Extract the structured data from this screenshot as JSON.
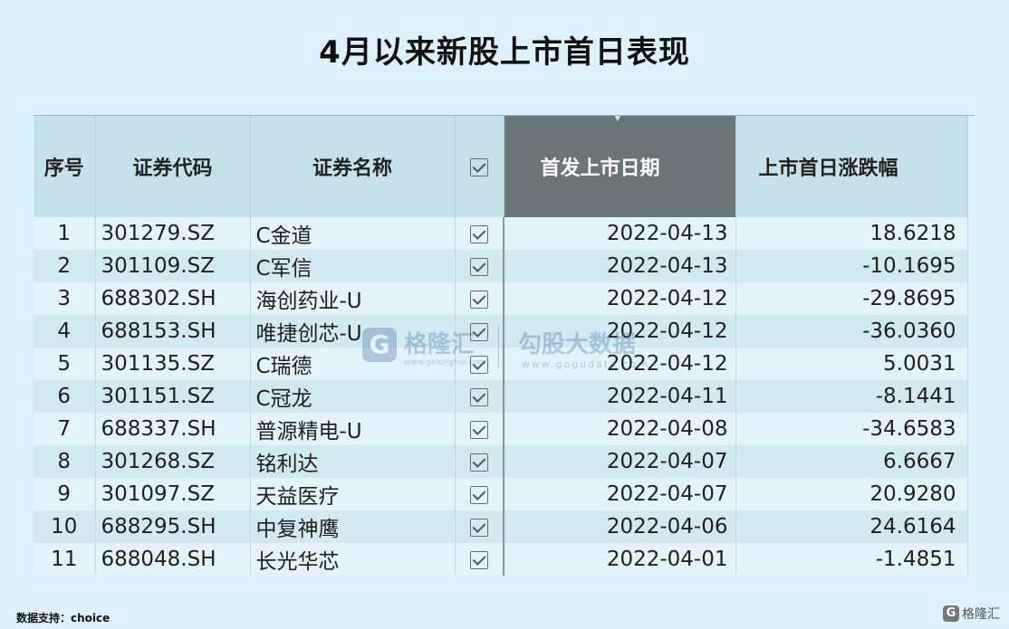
{
  "title": "4月以来新股上市首日表现",
  "table": {
    "headers": {
      "seq": "序号",
      "code": "证券代码",
      "name": "证券名称",
      "date": "首发上市日期",
      "change": "上市首日涨跌幅"
    },
    "rows": [
      {
        "seq": "1",
        "code": "301279.SZ",
        "name": "C金道",
        "date": "2022-04-13",
        "change": "18.6218"
      },
      {
        "seq": "2",
        "code": "301109.SZ",
        "name": "C军信",
        "date": "2022-04-13",
        "change": "-10.1695"
      },
      {
        "seq": "3",
        "code": "688302.SH",
        "name": "海创药业-U",
        "date": "2022-04-12",
        "change": "-29.8695"
      },
      {
        "seq": "4",
        "code": "688153.SH",
        "name": "唯捷创芯-U",
        "date": "2022-04-12",
        "change": "-36.0360"
      },
      {
        "seq": "5",
        "code": "301135.SZ",
        "name": "C瑞德",
        "date": "2022-04-12",
        "change": "5.0031"
      },
      {
        "seq": "6",
        "code": "301151.SZ",
        "name": "C冠龙",
        "date": "2022-04-11",
        "change": "-8.1441"
      },
      {
        "seq": "7",
        "code": "688337.SH",
        "name": "普源精电-U",
        "date": "2022-04-08",
        "change": "-34.6583"
      },
      {
        "seq": "8",
        "code": "301268.SZ",
        "name": "铭利达",
        "date": "2022-04-07",
        "change": "6.6667"
      },
      {
        "seq": "9",
        "code": "301097.SZ",
        "name": "天益医疗",
        "date": "2022-04-07",
        "change": "20.9280"
      },
      {
        "seq": "10",
        "code": "688295.SH",
        "name": "中复神鹰",
        "date": "2022-04-06",
        "change": "24.6164"
      },
      {
        "seq": "11",
        "code": "688048.SH",
        "name": "长光华芯",
        "date": "2022-04-01",
        "change": "-1.4851"
      }
    ]
  },
  "watermark": {
    "brand1": "格隆汇",
    "url1": "www.gelonghui.com",
    "brand2": "勾股大数据",
    "url2": "www.gogudata.com"
  },
  "footer": {
    "source": "数据支持：choice",
    "logo_text": "格隆汇"
  }
}
